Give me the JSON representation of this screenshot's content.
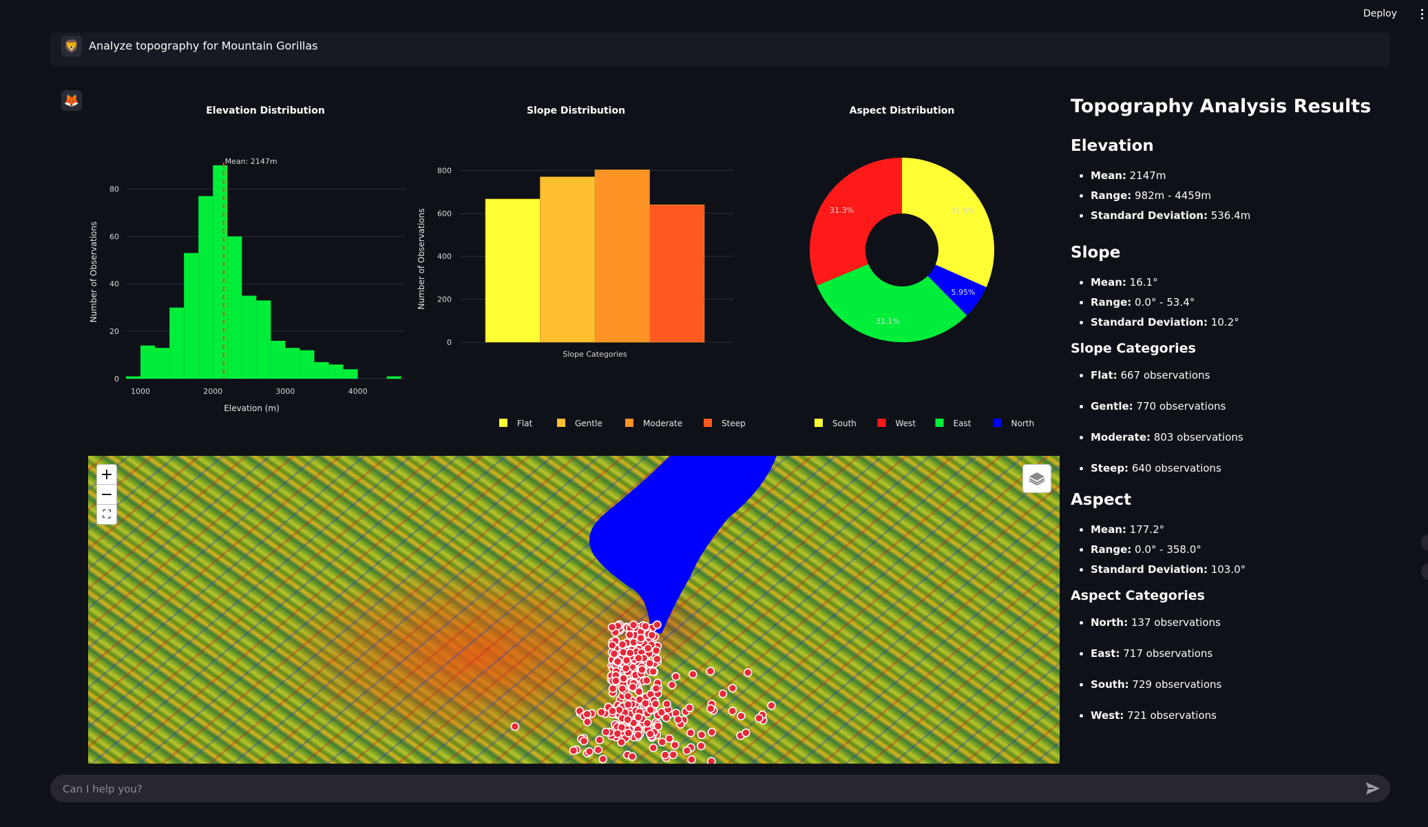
{
  "header": {
    "deploy_label": "Deploy"
  },
  "chat": {
    "user_message": "Analyze topography for Mountain Gorillas",
    "input_placeholder": "Can I help you?"
  },
  "icons": {
    "user_avatar": "lion-face-icon",
    "assistant_avatar": "fox-face-icon",
    "send": "send-arrow-icon",
    "map_layers": "layers-icon"
  },
  "map": {
    "zoom_in": "+",
    "zoom_out": "−"
  },
  "chart_data": [
    {
      "type": "bar",
      "title": "Elevation Distribution",
      "xlabel": "Elevation (m)",
      "ylabel": "Number of Observations",
      "x_ticks": [
        1000,
        2000,
        3000,
        4000
      ],
      "y_ticks": [
        0,
        20,
        40,
        60,
        80
      ],
      "xlim": [
        800,
        4650
      ],
      "ylim": [
        0,
        90
      ],
      "bin_width": 200,
      "bins_start": [
        800,
        1000,
        1200,
        1400,
        1600,
        1800,
        2000,
        2200,
        2400,
        2600,
        2800,
        3000,
        3200,
        3400,
        3600,
        3800,
        4000,
        4200,
        4400
      ],
      "values": [
        1,
        14,
        13,
        30,
        53,
        77,
        90,
        60,
        35,
        33,
        16,
        13,
        12,
        7,
        6,
        4,
        0,
        0,
        1
      ],
      "annotation": "Mean: 2147m",
      "mean": 2147,
      "color": "#00ee3a",
      "mean_line_color": "#ff3b3b"
    },
    {
      "type": "bar",
      "title": "Slope Distribution",
      "xlabel": "Slope Categories",
      "ylabel": "Number of Observations",
      "y_ticks": [
        0,
        200,
        400,
        600,
        800
      ],
      "ylim": [
        0,
        840
      ],
      "categories": [
        "Flat",
        "Gentle",
        "Moderate",
        "Steep"
      ],
      "values": [
        667,
        770,
        803,
        640
      ],
      "colors": [
        "#ffff33",
        "#ffbf2e",
        "#ff9326",
        "#ff5a1f"
      ]
    },
    {
      "type": "pie",
      "title": "Aspect Distribution",
      "labels": [
        "South",
        "West",
        "East",
        "North"
      ],
      "values": [
        31.6,
        31.3,
        31.1,
        5.95
      ],
      "slice_labels": [
        "31.6%",
        "31.3%",
        "31.1%",
        "5.95%"
      ],
      "order_clockwise_from_top": [
        "South",
        "North",
        "East",
        "West"
      ],
      "colors": {
        "South": "#ffff33",
        "West": "#ff1a1a",
        "East": "#00ee3a",
        "North": "#0000ff"
      }
    }
  ],
  "results": {
    "title": "Topography Analysis Results",
    "elevation_heading": "Elevation",
    "elevation": [
      {
        "label": "Mean:",
        "value": " 2147m"
      },
      {
        "label": "Range:",
        "value": " 982m - 4459m"
      },
      {
        "label": "Standard Deviation:",
        "value": " 536.4m"
      }
    ],
    "slope_heading": "Slope",
    "slope": [
      {
        "label": "Mean:",
        "value": " 16.1°"
      },
      {
        "label": "Range:",
        "value": " 0.0° - 53.4°"
      },
      {
        "label": "Standard Deviation:",
        "value": " 10.2°"
      }
    ],
    "slope_categories_heading": "Slope Categories",
    "slope_categories": [
      {
        "label": "Flat:",
        "value": " 667 observations"
      },
      {
        "label": "Gentle:",
        "value": " 770 observations"
      },
      {
        "label": "Moderate:",
        "value": " 803 observations"
      },
      {
        "label": "Steep:",
        "value": " 640 observations"
      }
    ],
    "aspect_heading": "Aspect",
    "aspect": [
      {
        "label": "Mean:",
        "value": " 177.2°"
      },
      {
        "label": "Range:",
        "value": " 0.0° - 358.0°"
      },
      {
        "label": "Standard Deviation:",
        "value": " 103.0°"
      }
    ],
    "aspect_categories_heading": "Aspect Categories",
    "aspect_categories": [
      {
        "label": "North:",
        "value": " 137 observations"
      },
      {
        "label": "East:",
        "value": " 717 observations"
      },
      {
        "label": "South:",
        "value": " 729 observations"
      },
      {
        "label": "West:",
        "value": " 721 observations"
      }
    ]
  }
}
